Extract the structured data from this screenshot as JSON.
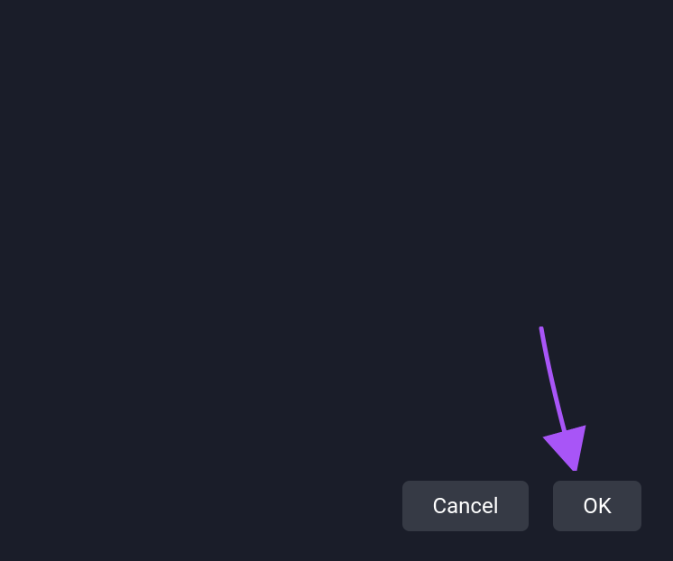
{
  "dialog": {
    "cancel_label": "Cancel",
    "ok_label": "OK"
  },
  "annotation": {
    "arrow_color": "#a855f7"
  }
}
